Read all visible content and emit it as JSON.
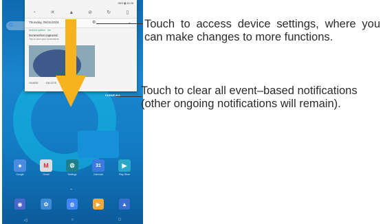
{
  "status_bar": {
    "battery": "96%",
    "time": "22:26"
  },
  "quick_settings": {
    "icons": [
      "wifi-icon",
      "bluetooth-off-icon",
      "notification-icon",
      "do-not-disturb-icon",
      "auto-rotate-icon",
      "flashlight-icon"
    ]
  },
  "shade": {
    "date": "Thursday, 05/31/2018",
    "notification": {
      "app": "Android system · 4m",
      "title": "Screenshot captured.",
      "subtitle": "Tap to view your screenshot.",
      "actions": [
        "SHARE",
        "DELETE"
      ]
    },
    "clear_all": "CLEAR ALL"
  },
  "apps": [
    {
      "label": "Google",
      "glyph": "●",
      "color": "#4a8de0"
    },
    {
      "label": "Gmail",
      "glyph": "M",
      "color": "#d9dde3"
    },
    {
      "label": "Settings",
      "glyph": "⚙",
      "color": "#1e7f8c"
    },
    {
      "label": "Calendar",
      "glyph": "31",
      "color": "#3b7be0"
    },
    {
      "label": "Play Store",
      "glyph": "▶",
      "color": "#2aa7c9"
    }
  ],
  "dock": [
    {
      "glyph": "◉",
      "color": "#4a67c9"
    },
    {
      "glyph": "✿",
      "color": "#3f8bd8"
    },
    {
      "glyph": "◍",
      "color": "#4285f4"
    },
    {
      "glyph": "▶",
      "color": "#f0a93b"
    },
    {
      "glyph": "▲",
      "color": "#3b6ed1"
    }
  ],
  "nav": [
    "◁",
    "○",
    "□"
  ],
  "callouts": {
    "settings": "Touch to access device settings, where you can make changes to more functions.",
    "clear": "Touch to clear all event–based notifications (other ongoing notifications will remain)."
  },
  "colors": {
    "arrow": "#f6b21f",
    "wallpaper": "#1a86cf"
  }
}
